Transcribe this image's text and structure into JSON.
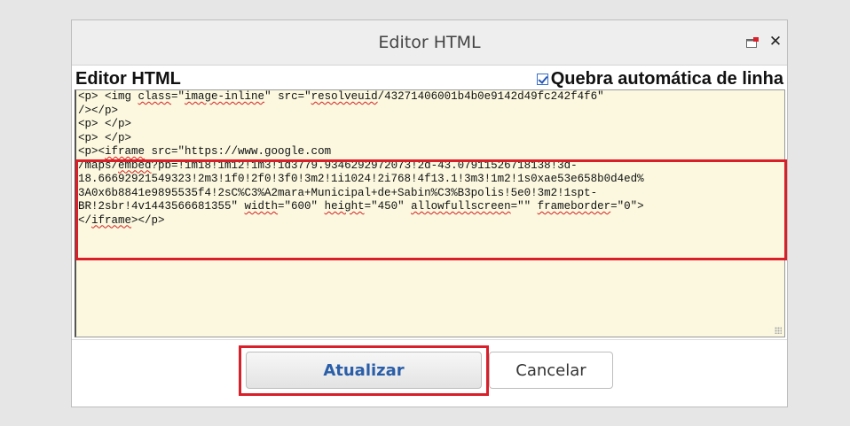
{
  "dialog": {
    "title": "Editor HTML",
    "maximize_icon": "maximize-icon",
    "close_glyph": "✕"
  },
  "editor": {
    "label": "Editor HTML",
    "wrap_label": "Quebra automática de linha",
    "wrap_checked": true,
    "lines": [
      "<p> <img class=\"image-inline\" src=\"resolveuid/43271406001b4b0e9142d49fc242f4f6\"",
      "/></p>",
      "<p> </p>",
      "<p> </p>",
      "<p><iframe src=\"https://www.google.com",
      "/maps/embed?pb=!1m18!1m12!1m3!1d3779.9346292972073!2d-43.07911526718138!3d-",
      "18.66692921549323!2m3!1f0!2f0!3f0!3m2!1i1024!2i768!4f13.1!3m3!1m2!1s0xae53e658b0d4ed%",
      "3A0x6b8841e9895535f4!2sC%C3%A2mara+Municipal+de+Sabin%C3%B3polis!5e0!3m2!1spt-",
      "BR!2sbr!4v1443566681355\" width=\"600\" height=\"450\" allowfullscreen=\"\" frameborder=\"0\">",
      "</iframe></p>"
    ]
  },
  "buttons": {
    "update": "Atualizar",
    "cancel": "Cancelar"
  },
  "colors": {
    "highlight": "#d9202a",
    "code_bg": "#fbf8df",
    "primary_text": "#2a5ea8"
  }
}
